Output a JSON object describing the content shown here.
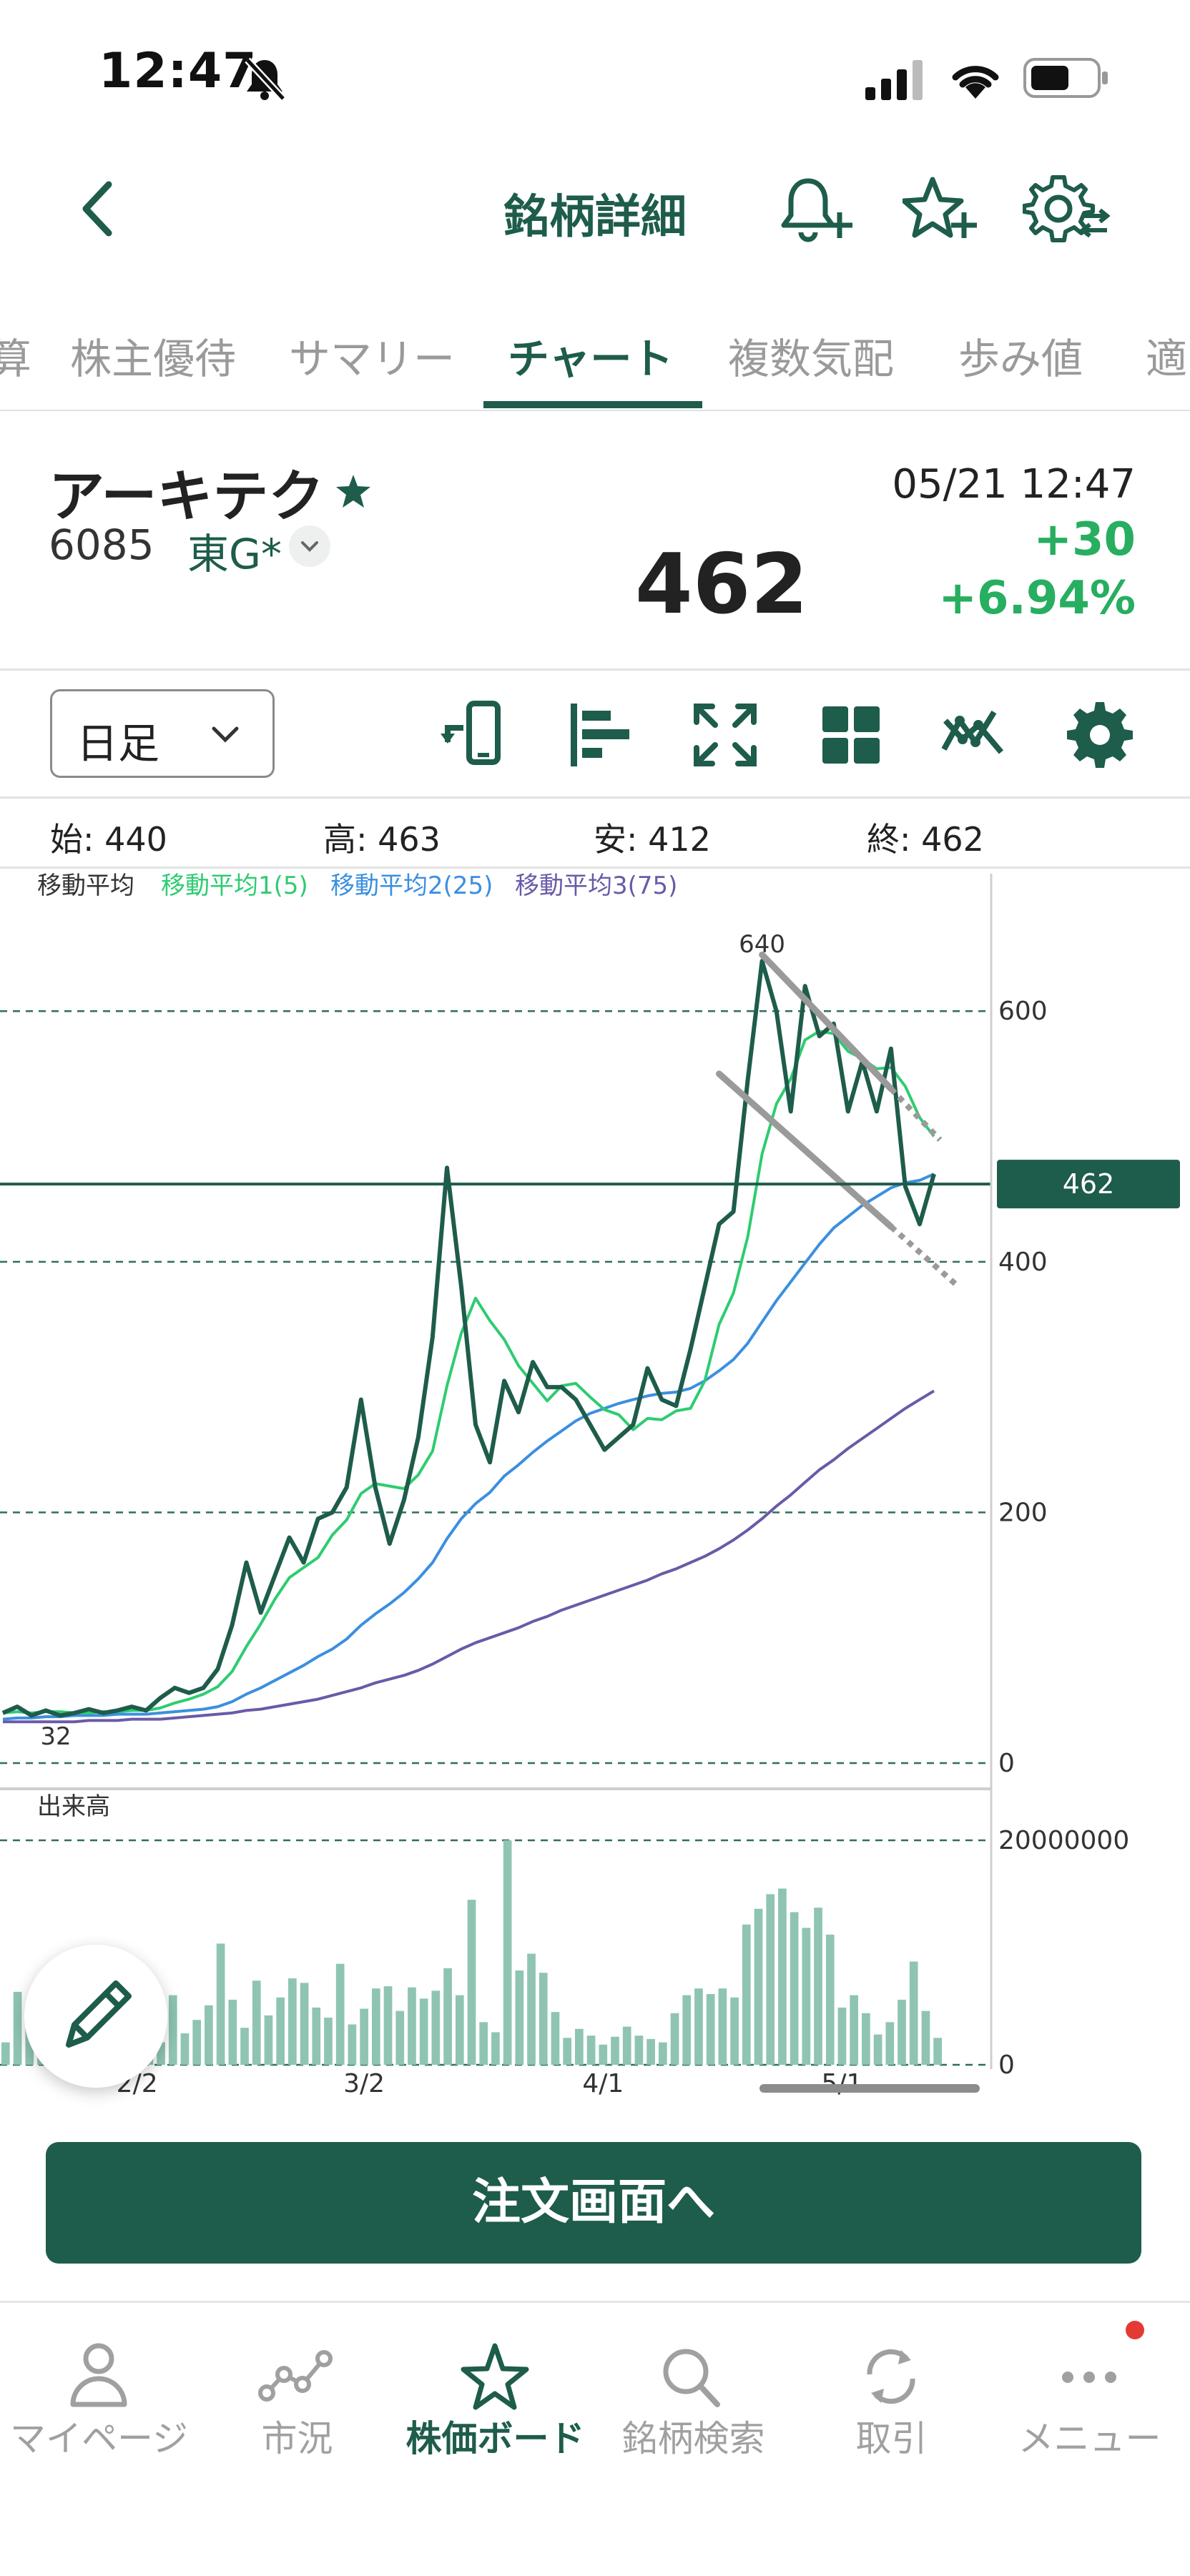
{
  "status_bar": {
    "time": "12:47"
  },
  "header": {
    "title": "銘柄詳細"
  },
  "tabs": [
    {
      "label": "算"
    },
    {
      "label": "株主優待"
    },
    {
      "label": "サマリー"
    },
    {
      "label": "チャート",
      "active": true
    },
    {
      "label": "複数気配"
    },
    {
      "label": "歩み値"
    },
    {
      "label": "適"
    }
  ],
  "stock": {
    "name": "アーキテク",
    "code": "6085",
    "market": "東G*",
    "datetime": "05/21 12:47",
    "price": "462",
    "change": "+30",
    "change_pct": "+6.94%"
  },
  "toolbar": {
    "period": "日足",
    "icons": [
      "rotate-phone-icon",
      "indicator-bars-icon",
      "fullscreen-icon",
      "layout-grid-icon",
      "draw-trend-icon",
      "settings-icon"
    ]
  },
  "ohlc": {
    "open_label": "始:",
    "open": "440",
    "high_label": "高:",
    "high": "463",
    "low_label": "安:",
    "low": "412",
    "close_label": "終:",
    "close": "462"
  },
  "colors": {
    "brand": "#1e5c4b",
    "price_line": "#1e5c4b",
    "ma1": "#2ecc71",
    "ma2": "#3b8fe0",
    "ma3": "#6a5aa8",
    "volume": "#8fc4b3",
    "up": "#27ae60",
    "alert_dot": "#e53935"
  },
  "chart_data": {
    "type": "line",
    "legend": {
      "title": "移動平均",
      "ma1": "移動平均1(5)",
      "ma2": "移動平均2(25)",
      "ma3": "移動平均3(75)"
    },
    "x_labels": [
      "2/2",
      "3/2",
      "4/1",
      "5/1"
    ],
    "x_label_index": [
      11,
      30,
      50,
      70
    ],
    "price_axis": {
      "ylim": [
        0,
        680
      ],
      "ticks": [
        0,
        200,
        400,
        600
      ]
    },
    "volume_axis": {
      "title": "出来高",
      "ylim": [
        0,
        20000000
      ],
      "ticks": [
        0,
        20000000
      ],
      "tick_labels": [
        "0",
        "20000000"
      ]
    },
    "high_label": "640",
    "low_label": "32",
    "current_price_label": "462",
    "close": [
      40,
      45,
      38,
      42,
      38,
      40,
      43,
      40,
      42,
      45,
      42,
      52,
      60,
      56,
      60,
      75,
      110,
      160,
      120,
      150,
      180,
      160,
      195,
      200,
      220,
      290,
      220,
      175,
      210,
      260,
      340,
      475,
      380,
      270,
      240,
      305,
      280,
      320,
      300,
      300,
      290,
      270,
      250,
      260,
      270,
      315,
      290,
      285,
      330,
      380,
      430,
      440,
      545,
      640,
      600,
      520,
      620,
      580,
      590,
      520,
      560,
      520,
      570,
      460,
      430,
      470
    ],
    "ma5": [
      40,
      41,
      40,
      41,
      41,
      40,
      40,
      41,
      41,
      42,
      42,
      44,
      48,
      51,
      55,
      61,
      73,
      93,
      111,
      131,
      148,
      156,
      164,
      182,
      194,
      215,
      223,
      221,
      219,
      230,
      249,
      301,
      343,
      371,
      353,
      338,
      317,
      303,
      289,
      301,
      303,
      292,
      282,
      278,
      266,
      275,
      274,
      281,
      283,
      305,
      350,
      375,
      420,
      486,
      526,
      546,
      577,
      584,
      582,
      568,
      562,
      554,
      555,
      540,
      515,
      500
    ],
    "ma25": [
      35,
      36,
      36,
      37,
      37,
      38,
      38,
      38,
      39,
      39,
      39,
      40,
      41,
      42,
      43,
      45,
      49,
      55,
      60,
      66,
      72,
      78,
      85,
      91,
      99,
      110,
      119,
      127,
      136,
      147,
      160,
      179,
      195,
      207,
      216,
      229,
      238,
      248,
      257,
      265,
      273,
      279,
      283,
      287,
      290,
      293,
      295,
      296,
      299,
      305,
      313,
      322,
      335,
      352,
      369,
      384,
      399,
      414,
      427,
      436,
      445,
      452,
      459,
      463,
      465,
      470
    ],
    "ma75": [
      33,
      33,
      33,
      33,
      33,
      33,
      34,
      34,
      34,
      35,
      35,
      35,
      36,
      37,
      38,
      39,
      40,
      42,
      43,
      45,
      47,
      49,
      51,
      54,
      57,
      60,
      64,
      67,
      70,
      74,
      79,
      85,
      91,
      96,
      100,
      104,
      108,
      113,
      117,
      122,
      126,
      130,
      134,
      138,
      142,
      146,
      151,
      155,
      160,
      165,
      171,
      178,
      186,
      195,
      205,
      214,
      224,
      234,
      242,
      251,
      259,
      267,
      275,
      283,
      290,
      297
    ],
    "volume": [
      2000000,
      6500000,
      4000000,
      1500000,
      2500000,
      3000000,
      1000000,
      6000000,
      3500000,
      5000000,
      1500000,
      2200000,
      3000000,
      2000000,
      6200000,
      2800000,
      4000000,
      5300000,
      10800000,
      5800000,
      3300000,
      7500000,
      4400000,
      6000000,
      7700000,
      7300000,
      5100000,
      4200000,
      9000000,
      3600000,
      5000000,
      6800000,
      7000000,
      4800000,
      6900000,
      5900000,
      6600000,
      8600000,
      6200000,
      14700000,
      3800000,
      2900000,
      20000000,
      8400000,
      9900000,
      8200000,
      4700000,
      2400000,
      3200000,
      2600000,
      1800000,
      2500000,
      3400000,
      2600000,
      2300000,
      2000000,
      4600000,
      6200000,
      6800000,
      6300000,
      6800000,
      6000000,
      12500000,
      13900000,
      15200000,
      15700000,
      13600000,
      12200000,
      14000000,
      11600000,
      5100000,
      6200000,
      4600000,
      2700000,
      3800000,
      5800000,
      9200000,
      4800000,
      2400000
    ]
  },
  "fab": {
    "icon": "pencil-icon"
  },
  "order_button": {
    "label": "注文画面へ"
  },
  "bottom_nav": [
    {
      "label": "マイページ",
      "icon": "person-icon"
    },
    {
      "label": "市況",
      "icon": "market-graph-icon"
    },
    {
      "label": "株価ボード",
      "icon": "star-icon",
      "active": true
    },
    {
      "label": "銘柄検索",
      "icon": "search-icon"
    },
    {
      "label": "取引",
      "icon": "refresh-icon"
    },
    {
      "label": "メニュー",
      "icon": "more-dots-icon"
    }
  ]
}
